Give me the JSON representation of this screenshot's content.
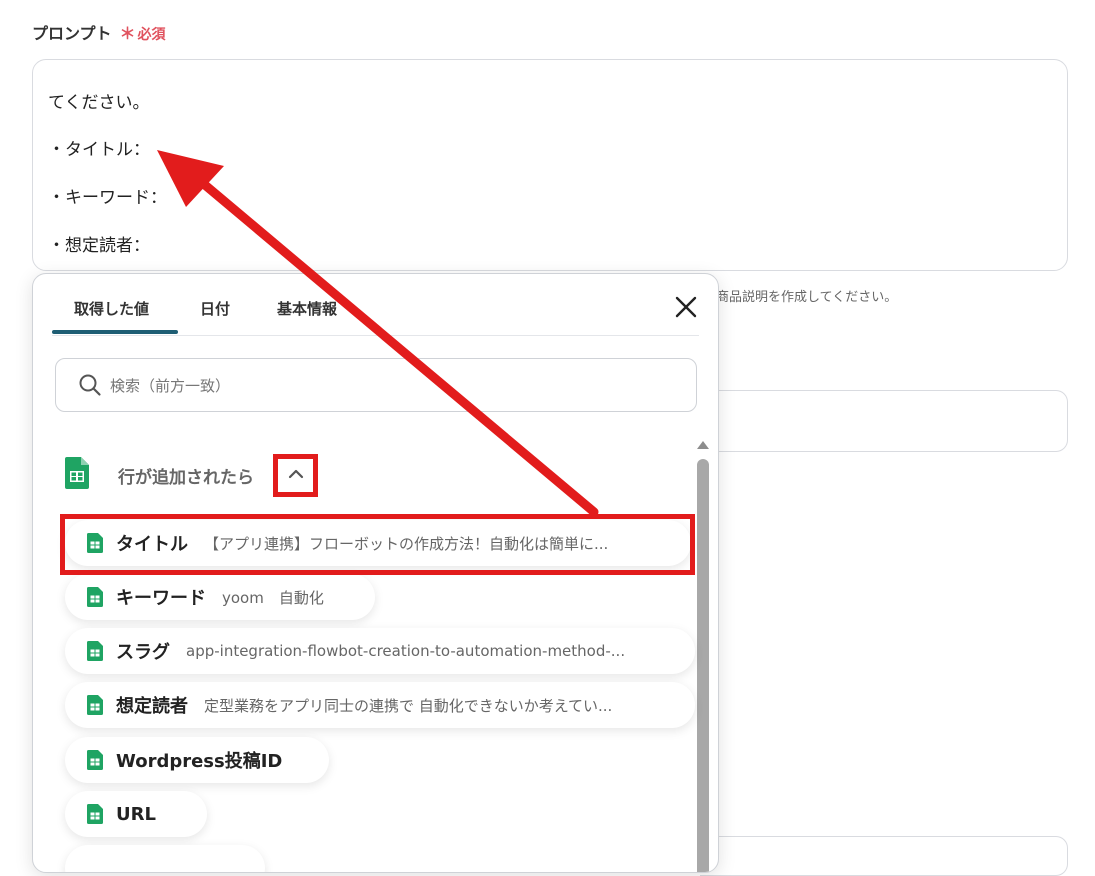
{
  "form": {
    "label": "プロンプト",
    "required_star": "＊",
    "required_text": "必須",
    "prompt_lines": [
      "てください。",
      "・タイトル：",
      "・キーワード：",
      "・想定読者："
    ],
    "help_text": "商品説明を作成してください。"
  },
  "popup": {
    "tabs": [
      "取得した値",
      "日付",
      "基本情報"
    ],
    "search_placeholder": "検索（前方一致）",
    "section_label": "行が追加されたら",
    "items": [
      {
        "name": "タイトル",
        "value": "【アプリ連携】フローボットの作成方法！自動化は簡単に..."
      },
      {
        "name": "キーワード",
        "value": "yoom　自動化"
      },
      {
        "name": "スラグ",
        "value": "app-integration-flowbot-creation-to-automation-method-..."
      },
      {
        "name": "想定読者",
        "value": "定型業務をアプリ同士の連携で 自動化できないか考えてい..."
      },
      {
        "name": "Wordpress投稿ID",
        "value": ""
      },
      {
        "name": "URL",
        "value": ""
      }
    ]
  },
  "colors": {
    "accent_tab": "#1e5e74",
    "required": "#e0525e",
    "highlight": "#e21c1c",
    "sheets_green": "#1fa463"
  },
  "icons": {
    "search": "search-icon",
    "close": "close-icon",
    "collapse": "chevron-up-icon",
    "sheets": "google-sheets-icon"
  }
}
